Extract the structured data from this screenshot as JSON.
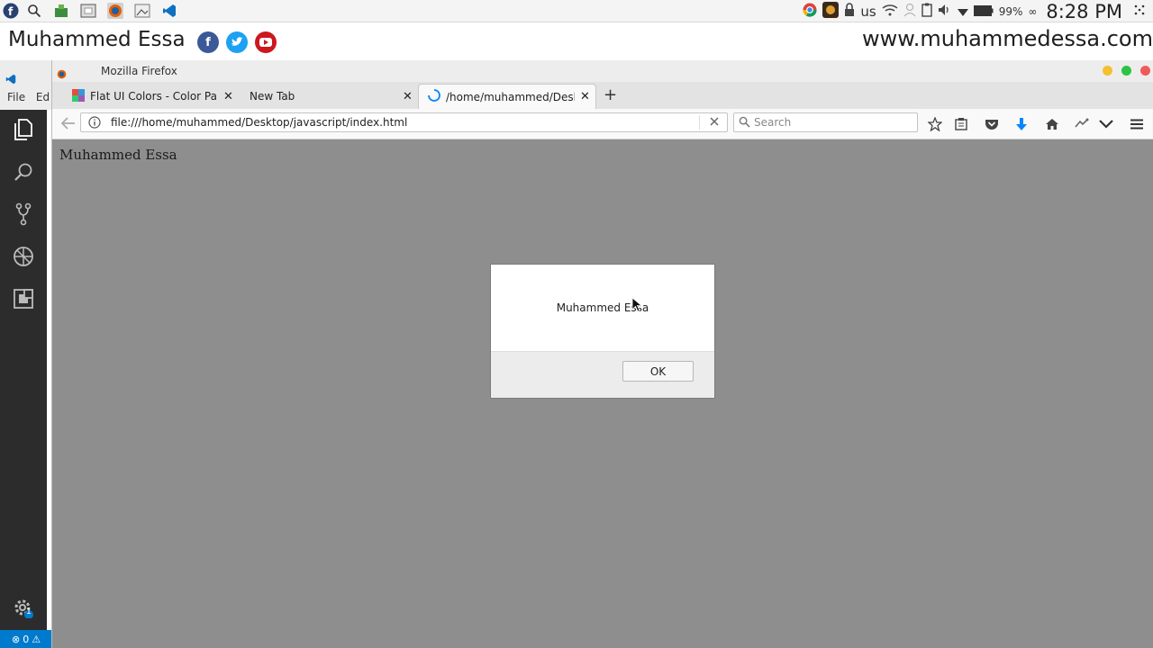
{
  "banner": {
    "name": "Muhammed Essa",
    "url": "www.muhammedessa.com",
    "social": [
      "facebook-icon",
      "twitter-icon",
      "youtube-icon"
    ]
  },
  "system_tray": {
    "keyboard_layout": "us",
    "battery": "99%",
    "clock": "8:28 PM"
  },
  "vscode": {
    "menu": [
      "File",
      "Ed"
    ],
    "activity_icons": [
      "explorer-icon",
      "search-icon",
      "source-control-icon",
      "debug-icon",
      "extensions-icon"
    ],
    "settings_badge": "1",
    "status_errors": "0"
  },
  "firefox": {
    "window_title": "Mozilla Firefox",
    "tabs": [
      {
        "label": "Flat UI Colors - Color Palle",
        "active": false
      },
      {
        "label": "New Tab",
        "active": false
      },
      {
        "label": "/home/muhammed/Desk",
        "active": true
      }
    ],
    "url": "file:///home/muhammed/Desktop/javascript/index.html",
    "search_placeholder": "Search"
  },
  "page": {
    "text": "Muhammed Essa"
  },
  "dialog": {
    "message": "Muhammed Essa",
    "ok_label": "OK"
  },
  "colors": {
    "content_bg": "#8e8e8e",
    "vscode_activity": "#2c2c2c",
    "vscode_status": "#007acc",
    "facebook": "#3b5998",
    "twitter": "#1da1f2",
    "youtube": "#cc181e"
  }
}
